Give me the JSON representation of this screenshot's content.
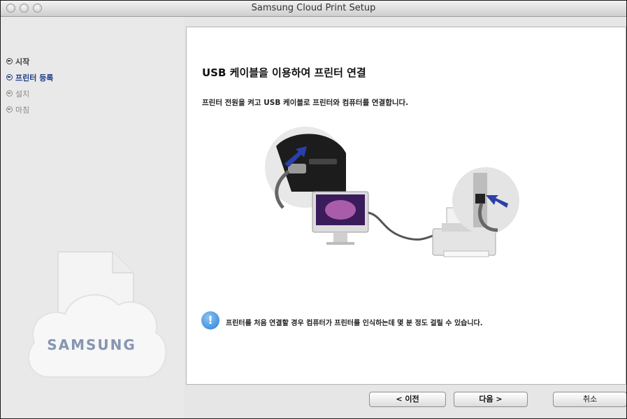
{
  "window": {
    "title": "Samsung Cloud Print Setup"
  },
  "sidebar": {
    "steps": [
      {
        "label": "시작",
        "state": "done"
      },
      {
        "label": "프린터 등록",
        "state": "active"
      },
      {
        "label": "설치",
        "state": "pending"
      },
      {
        "label": "마침",
        "state": "pending"
      }
    ],
    "logo_text": "SAMSUNG"
  },
  "main": {
    "heading": "USB 케이블을 이용하여 프린터 연결",
    "instruction": "프린터 전원을 켜고 USB 케이블로 프린터와 컴퓨터를 연결합니다.",
    "notice": "프린터를 처음 연결할 경우 컴퓨터가 프린터를 인식하는데 몇 분 정도 걸릴 수 있습니다."
  },
  "buttons": {
    "back": "< 이전",
    "next": "다음 >",
    "cancel": "취소"
  },
  "colors": {
    "active_step": "#1e3c88",
    "logo": "#8695b3",
    "info_icon": "#2a7fd4",
    "arrow": "#2b3fa8"
  }
}
